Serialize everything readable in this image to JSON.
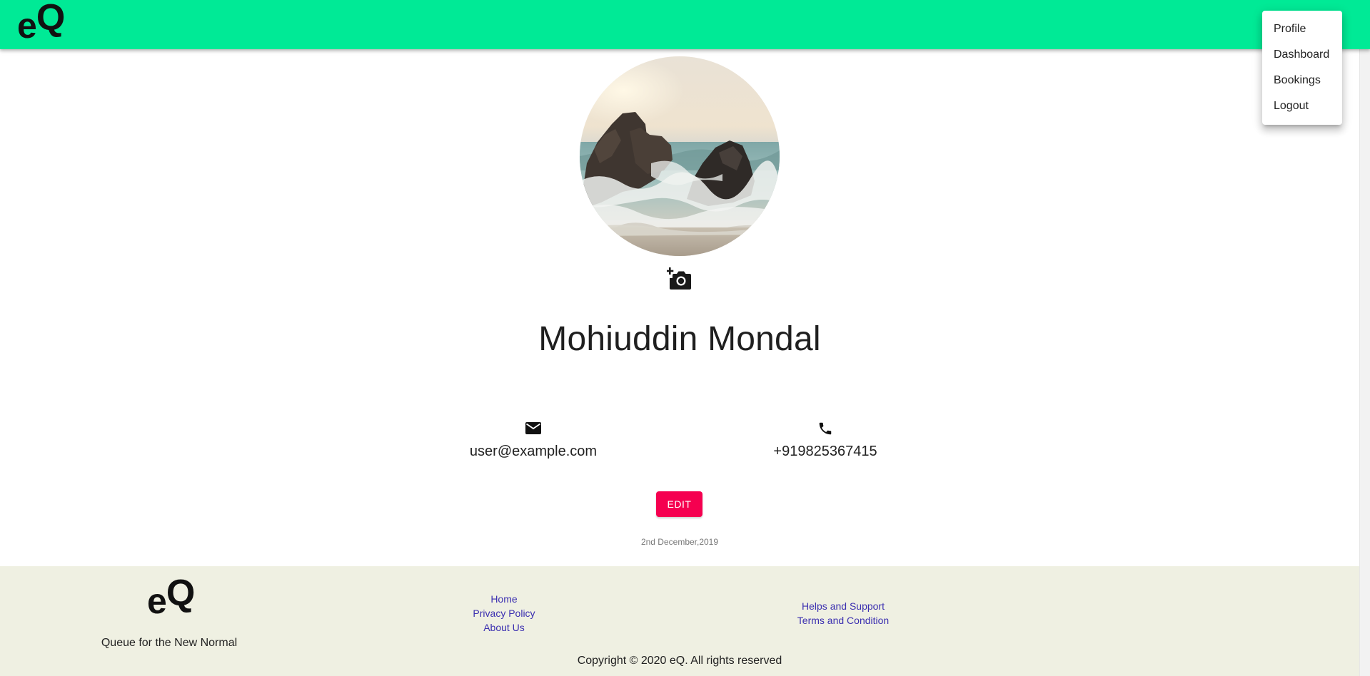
{
  "brand": {
    "logo_e": "e",
    "logo_q": "Q",
    "header_color": "#00ea96",
    "accent_color": "#f50050",
    "footer_bg": "#eff0e2",
    "link_color": "#3b2fb0"
  },
  "menu": {
    "items": [
      {
        "label": "Profile"
      },
      {
        "label": "Dashboard"
      },
      {
        "label": "Bookings"
      },
      {
        "label": "Logout"
      }
    ]
  },
  "profile": {
    "avatar_icon": "beach-rocks-photo",
    "camera_icon": "add-a-photo-icon",
    "name": "Mohiuddin Mondal",
    "email_icon": "mail-icon",
    "email": "user@example.com",
    "phone_icon": "phone-icon",
    "phone": "+919825367415",
    "edit_label": "EDIT",
    "date": "2nd December,2019"
  },
  "footer": {
    "logo_e": "e",
    "logo_q": "Q",
    "tagline": "Queue for the New Normal",
    "links_col1": [
      "Home",
      "Privacy Policy",
      "About Us"
    ],
    "links_col2": [
      "Helps and Support",
      "Terms and Condition"
    ],
    "copyright": "Copyright © 2020 eQ. All rights reserved"
  }
}
